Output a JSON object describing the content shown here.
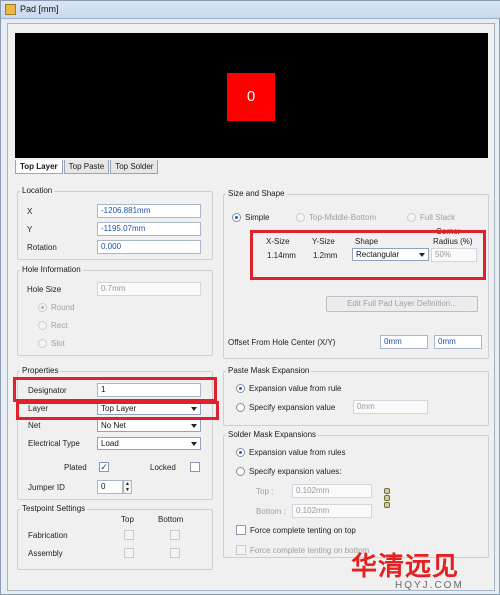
{
  "window": {
    "title": "Pad [mm]"
  },
  "preview": {
    "pad_label": "0",
    "pad_color": "#ff0000"
  },
  "tabs": [
    {
      "label": "Top Layer",
      "active": true
    },
    {
      "label": "Top Paste",
      "active": false
    },
    {
      "label": "Top Solder",
      "active": false
    }
  ],
  "location": {
    "title": "Location",
    "x_label": "X",
    "x_value": "-1206.881mm",
    "y_label": "Y",
    "y_value": "-1195.07mm",
    "rotation_label": "Rotation",
    "rotation_value": "0.000"
  },
  "hole": {
    "title": "Hole Information",
    "size_label": "Hole Size",
    "size_value": "0.7mm",
    "round": "Round",
    "rect": "Rect",
    "slot": "Slot"
  },
  "properties": {
    "title": "Properties",
    "designator_label": "Designator",
    "designator_value": "1",
    "layer_label": "Layer",
    "layer_value": "Top Layer",
    "net_label": "Net",
    "net_value": "No Net",
    "electrical_label": "Electrical Type",
    "electrical_value": "Load",
    "plated_label": "Plated",
    "plated_checked": "✓",
    "locked_label": "Locked",
    "jumper_label": "Jumper ID",
    "jumper_value": "0"
  },
  "testpoint": {
    "title": "Testpoint Settings",
    "top_label": "Top",
    "bottom_label": "Bottom",
    "fabrication_label": "Fabrication",
    "assembly_label": "Assembly"
  },
  "size_shape": {
    "title": "Size and Shape",
    "simple": "Simple",
    "top_middle_bottom": "Top-Middle-Bottom",
    "full_stack": "Full Stack",
    "col_x": "X-Size",
    "col_y": "Y-Size",
    "col_shape": "Shape",
    "col_corner": "Corner",
    "col_radius": "Radius (%)",
    "x_value": "1.14mm",
    "y_value": "1.2mm",
    "shape_value": "Rectangular",
    "radius_value": "50%",
    "edit_button": "Edit Full Pad Layer Definition...",
    "offset_label": "Offset From Hole Center (X/Y)",
    "offset_x": "0mm",
    "offset_y": "0mm"
  },
  "paste_mask": {
    "title": "Paste Mask Expansion",
    "from_rule": "Expansion value from rule",
    "specify": "Specify expansion value",
    "specify_value": "0mm"
  },
  "solder_mask": {
    "title": "Solder Mask Expansions",
    "from_rules": "Expansion value from rules",
    "specify": "Specify expansion values:",
    "top_label": "Top :",
    "top_value": "0.102mm",
    "bottom_label": "Bottom :",
    "bottom_value": "0.102mm",
    "force_top": "Force complete tenting on top",
    "force_bottom": "Force complete tenting on bottom"
  },
  "watermark": {
    "cn": "华清远见",
    "en": "HQYJ.COM"
  },
  "colors": {
    "highlight": "#e0202a",
    "value_text": "#2050a8"
  }
}
